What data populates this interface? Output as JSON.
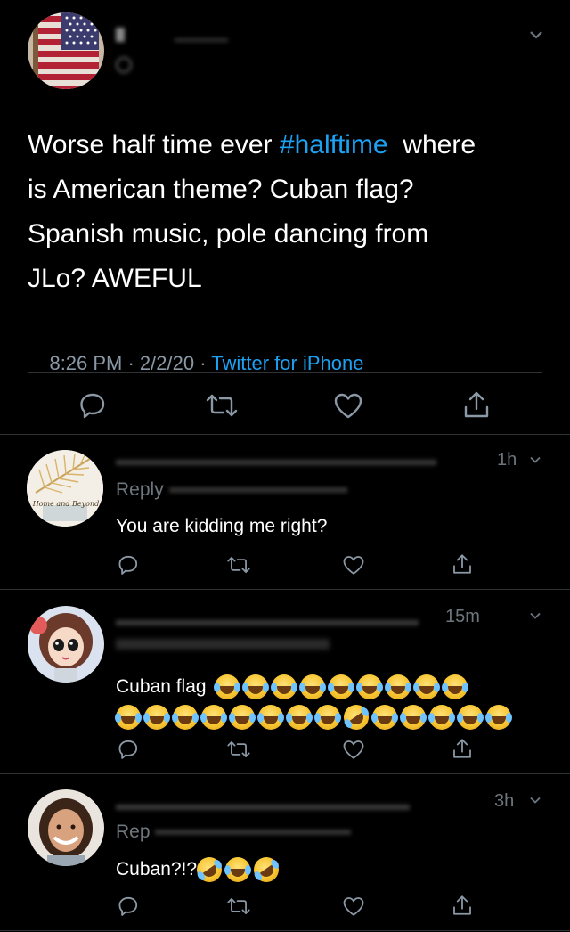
{
  "main_tweet": {
    "tweet_text_before": "Worse half time ever ",
    "hashtag": "#halftime",
    "tweet_text_line1_rest": "  where",
    "tweet_text_line2": "is American theme? Cuban flag?",
    "tweet_text_line3": "Spanish music, pole dancing from",
    "tweet_text_line4": "JLo? AWEFUL",
    "timestamp": "8:26 PM · 2/2/20 · ",
    "source": "Twitter for iPhone"
  },
  "replies": [
    {
      "avatar_caption": "Home and Beyond",
      "time": "1h",
      "replying_label": "Reply",
      "text": "You are kidding me right?"
    },
    {
      "time": "15m",
      "text": "Cuban flag"
    },
    {
      "time": "3h",
      "replying_label": "Rep",
      "text": "Cuban?!?"
    }
  ],
  "icons": {
    "chevron": "chevron-down-icon",
    "reply": "reply-icon",
    "retweet": "retweet-icon",
    "like": "heart-icon",
    "share": "share-icon"
  },
  "colors": {
    "background": "#000000",
    "link": "#1da1f2",
    "muted": "#8b98a5",
    "divider": "#2f3336"
  }
}
